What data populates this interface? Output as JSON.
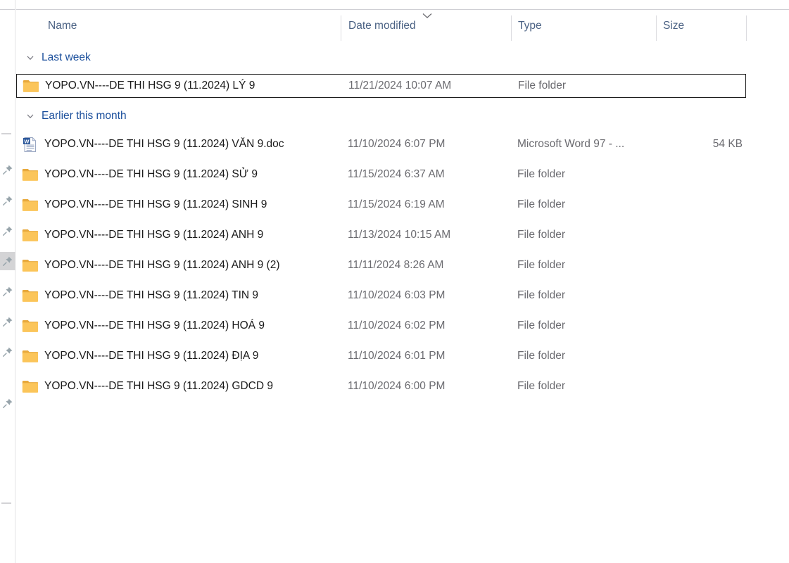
{
  "columns": {
    "name": "Name",
    "date_modified": "Date modified",
    "type": "Type",
    "size": "Size",
    "sort_column": "Date modified",
    "sort_direction": "descending",
    "sort_icon": "chevron-down-icon"
  },
  "left_rail": {
    "pin_icon": "pin-icon",
    "pin_count": 8,
    "active_pin_index": 3
  },
  "groups": [
    {
      "label": "Last week",
      "chevron_icon": "chevron-down-icon",
      "expanded": true,
      "items": [
        {
          "name": "YOPO.VN----DE THI HSG 9 (11.2024) LÝ 9",
          "date_modified": "11/21/2024 10:07 AM",
          "type": "File folder",
          "size": "",
          "icon": "folder-icon",
          "selected": true
        }
      ]
    },
    {
      "label": "Earlier this month",
      "chevron_icon": "chevron-down-icon",
      "expanded": true,
      "items": [
        {
          "name": "YOPO.VN----DE THI HSG 9 (11.2024) VĂN 9.doc",
          "date_modified": "11/10/2024 6:07 PM",
          "type": "Microsoft Word 97 - ...",
          "size": "54 KB",
          "icon": "word-document-icon",
          "selected": false
        },
        {
          "name": "YOPO.VN----DE THI HSG 9 (11.2024) SỬ 9",
          "date_modified": "11/15/2024 6:37 AM",
          "type": "File folder",
          "size": "",
          "icon": "folder-icon",
          "selected": false
        },
        {
          "name": "YOPO.VN----DE THI HSG 9 (11.2024) SINH 9",
          "date_modified": "11/15/2024 6:19 AM",
          "type": "File folder",
          "size": "",
          "icon": "folder-icon",
          "selected": false
        },
        {
          "name": "YOPO.VN----DE THI HSG 9 (11.2024) ANH 9",
          "date_modified": "11/13/2024 10:15 AM",
          "type": "File folder",
          "size": "",
          "icon": "folder-icon",
          "selected": false
        },
        {
          "name": "YOPO.VN----DE THI HSG 9 (11.2024) ANH 9 (2)",
          "date_modified": "11/11/2024 8:26 AM",
          "type": "File folder",
          "size": "",
          "icon": "folder-icon",
          "selected": false
        },
        {
          "name": "YOPO.VN----DE THI HSG 9 (11.2024) TIN 9",
          "date_modified": "11/10/2024 6:03 PM",
          "type": "File folder",
          "size": "",
          "icon": "folder-icon",
          "selected": false
        },
        {
          "name": "YOPO.VN----DE THI HSG 9 (11.2024) HOÁ 9",
          "date_modified": "11/10/2024 6:02 PM",
          "type": "File folder",
          "size": "",
          "icon": "folder-icon",
          "selected": false
        },
        {
          "name": "YOPO.VN----DE THI HSG 9 (11.2024) ĐỊA 9",
          "date_modified": "11/10/2024 6:01 PM",
          "type": "File folder",
          "size": "",
          "icon": "folder-icon",
          "selected": false
        },
        {
          "name": "YOPO.VN----DE THI HSG 9 (11.2024) GDCD 9",
          "date_modified": "11/10/2024 6:00 PM",
          "type": "File folder",
          "size": "",
          "icon": "folder-icon",
          "selected": false
        }
      ]
    }
  ],
  "colors": {
    "header_text": "#4a6183",
    "group_text": "#1b4f9c",
    "meta_text": "#6b6b70",
    "name_text": "#1a1a1a",
    "folder": "#fbc55a",
    "selection_border": "#1c1c1c"
  }
}
